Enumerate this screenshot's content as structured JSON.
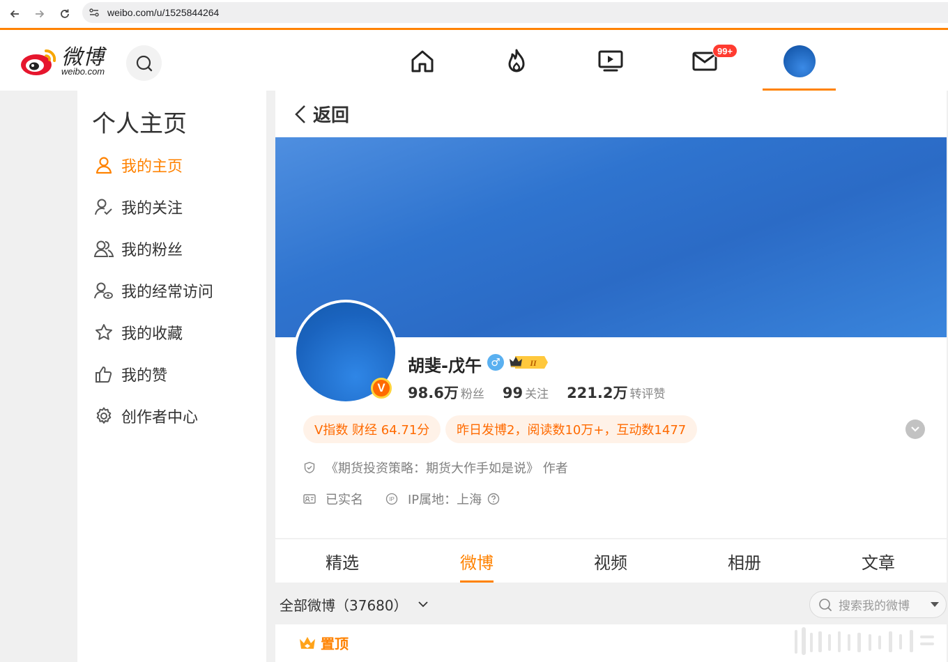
{
  "browser": {
    "url": "weibo.com/u/1525844264"
  },
  "header": {
    "logo_cn": "微博",
    "logo_en": "weibo.com",
    "messages_badge": "99+",
    "nav_icons": [
      "home-icon",
      "hot-icon",
      "video-icon",
      "mail-icon"
    ],
    "accent_color": "#ff8200"
  },
  "sidebar": {
    "title": "个人主页",
    "items": [
      {
        "label": "我的主页",
        "icon": "user-icon",
        "active": true
      },
      {
        "label": "我的关注",
        "icon": "user-check-icon"
      },
      {
        "label": "我的粉丝",
        "icon": "users-icon"
      },
      {
        "label": "我的经常访问",
        "icon": "user-visit-icon"
      },
      {
        "label": "我的收藏",
        "icon": "star-icon"
      },
      {
        "label": "我的赞",
        "icon": "thumbs-up-icon"
      },
      {
        "label": "创作者中心",
        "icon": "gear-icon"
      }
    ]
  },
  "main": {
    "back_label": "返回",
    "profile": {
      "name": "胡斐-戊午",
      "gender_symbol": "♂",
      "vip_level": "II",
      "followers_num": "98.6万",
      "followers_label": "粉丝",
      "following_num": "99",
      "following_label": "关注",
      "reposts_num": "221.2万",
      "reposts_label": "转评赞",
      "v_index": "V指数 财经 64.71分",
      "yesterday_stats": "昨日发博2，阅读数10万+，互动数1477",
      "bio": "《期货投资策略：期货大作手如是说》 作者",
      "verified": "已实名",
      "ip_location": "IP属地：上海"
    },
    "tabs": [
      {
        "label": "精选"
      },
      {
        "label": "微博",
        "active": true
      },
      {
        "label": "视频"
      },
      {
        "label": "相册"
      },
      {
        "label": "文章"
      }
    ],
    "filter_label": "全部微博（37680）",
    "search_placeholder": "搜索我的微博",
    "pinned_label": "置顶"
  }
}
